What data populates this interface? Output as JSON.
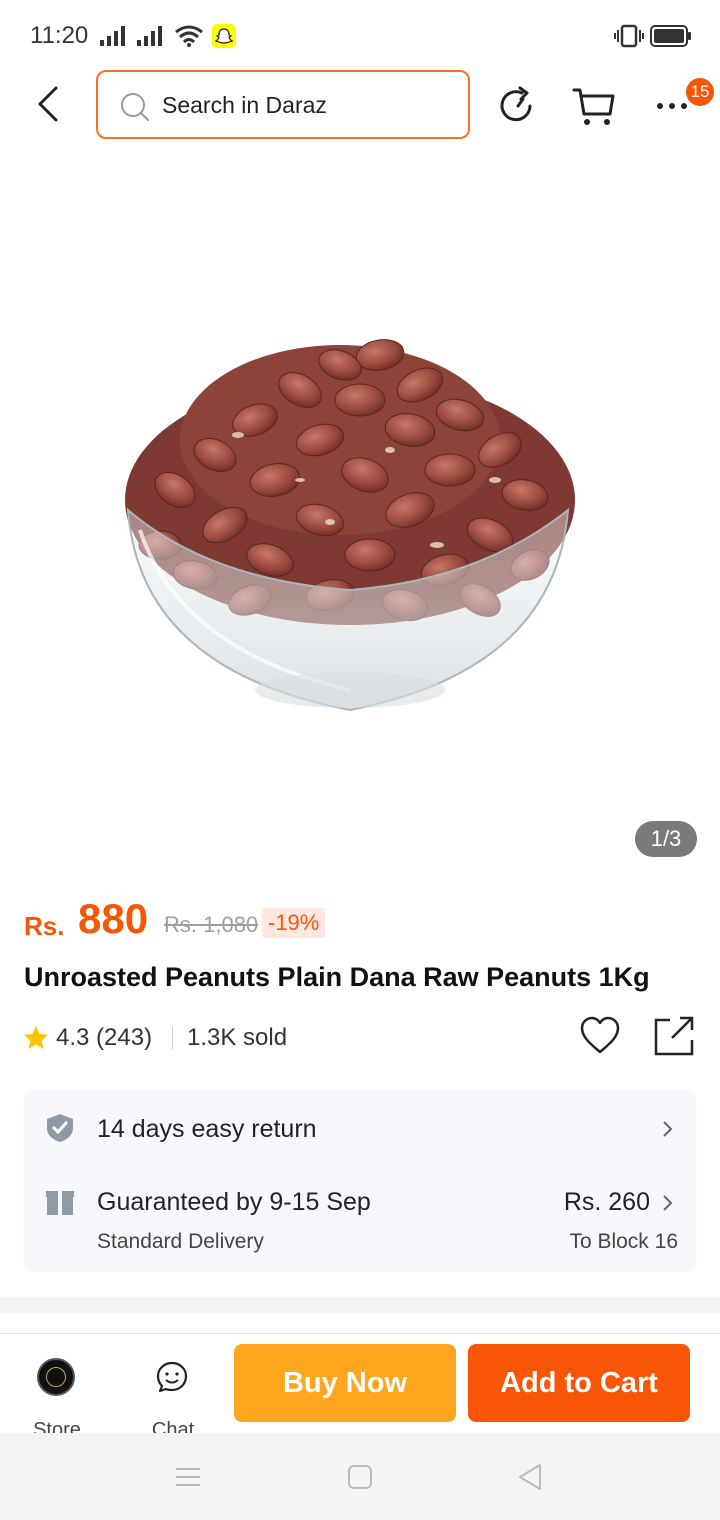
{
  "status_bar": {
    "time": "11:20"
  },
  "header": {
    "search_placeholder": "Search in Daraz",
    "cart_badge_count": "15",
    "icons": [
      "back-icon",
      "search-icon",
      "refresh-icon",
      "cart-icon",
      "more-icon"
    ]
  },
  "gallery": {
    "counter": "1/3"
  },
  "product": {
    "currency": "Rs.",
    "price": "880",
    "old_price": "Rs. 1,080",
    "discount": "-19%",
    "title": "Unroasted Peanuts Plain Dana Raw Peanuts 1Kg",
    "rating": "4.3 (243)",
    "sold": "1.3K sold"
  },
  "services": {
    "return_text": "14 days easy return",
    "delivery_title": "Guaranteed by 9-15 Sep",
    "delivery_type": "Standard Delivery",
    "delivery_fee": "Rs. 260",
    "delivery_location": "To Block 16"
  },
  "action_bar": {
    "store_label": "Store",
    "chat_label": "Chat",
    "buy_now": "Buy Now",
    "add_to_cart": "Add to Cart"
  },
  "colors": {
    "accent": "#F85606",
    "buy_now": "#FFA51E",
    "search_border": "#F57224"
  }
}
